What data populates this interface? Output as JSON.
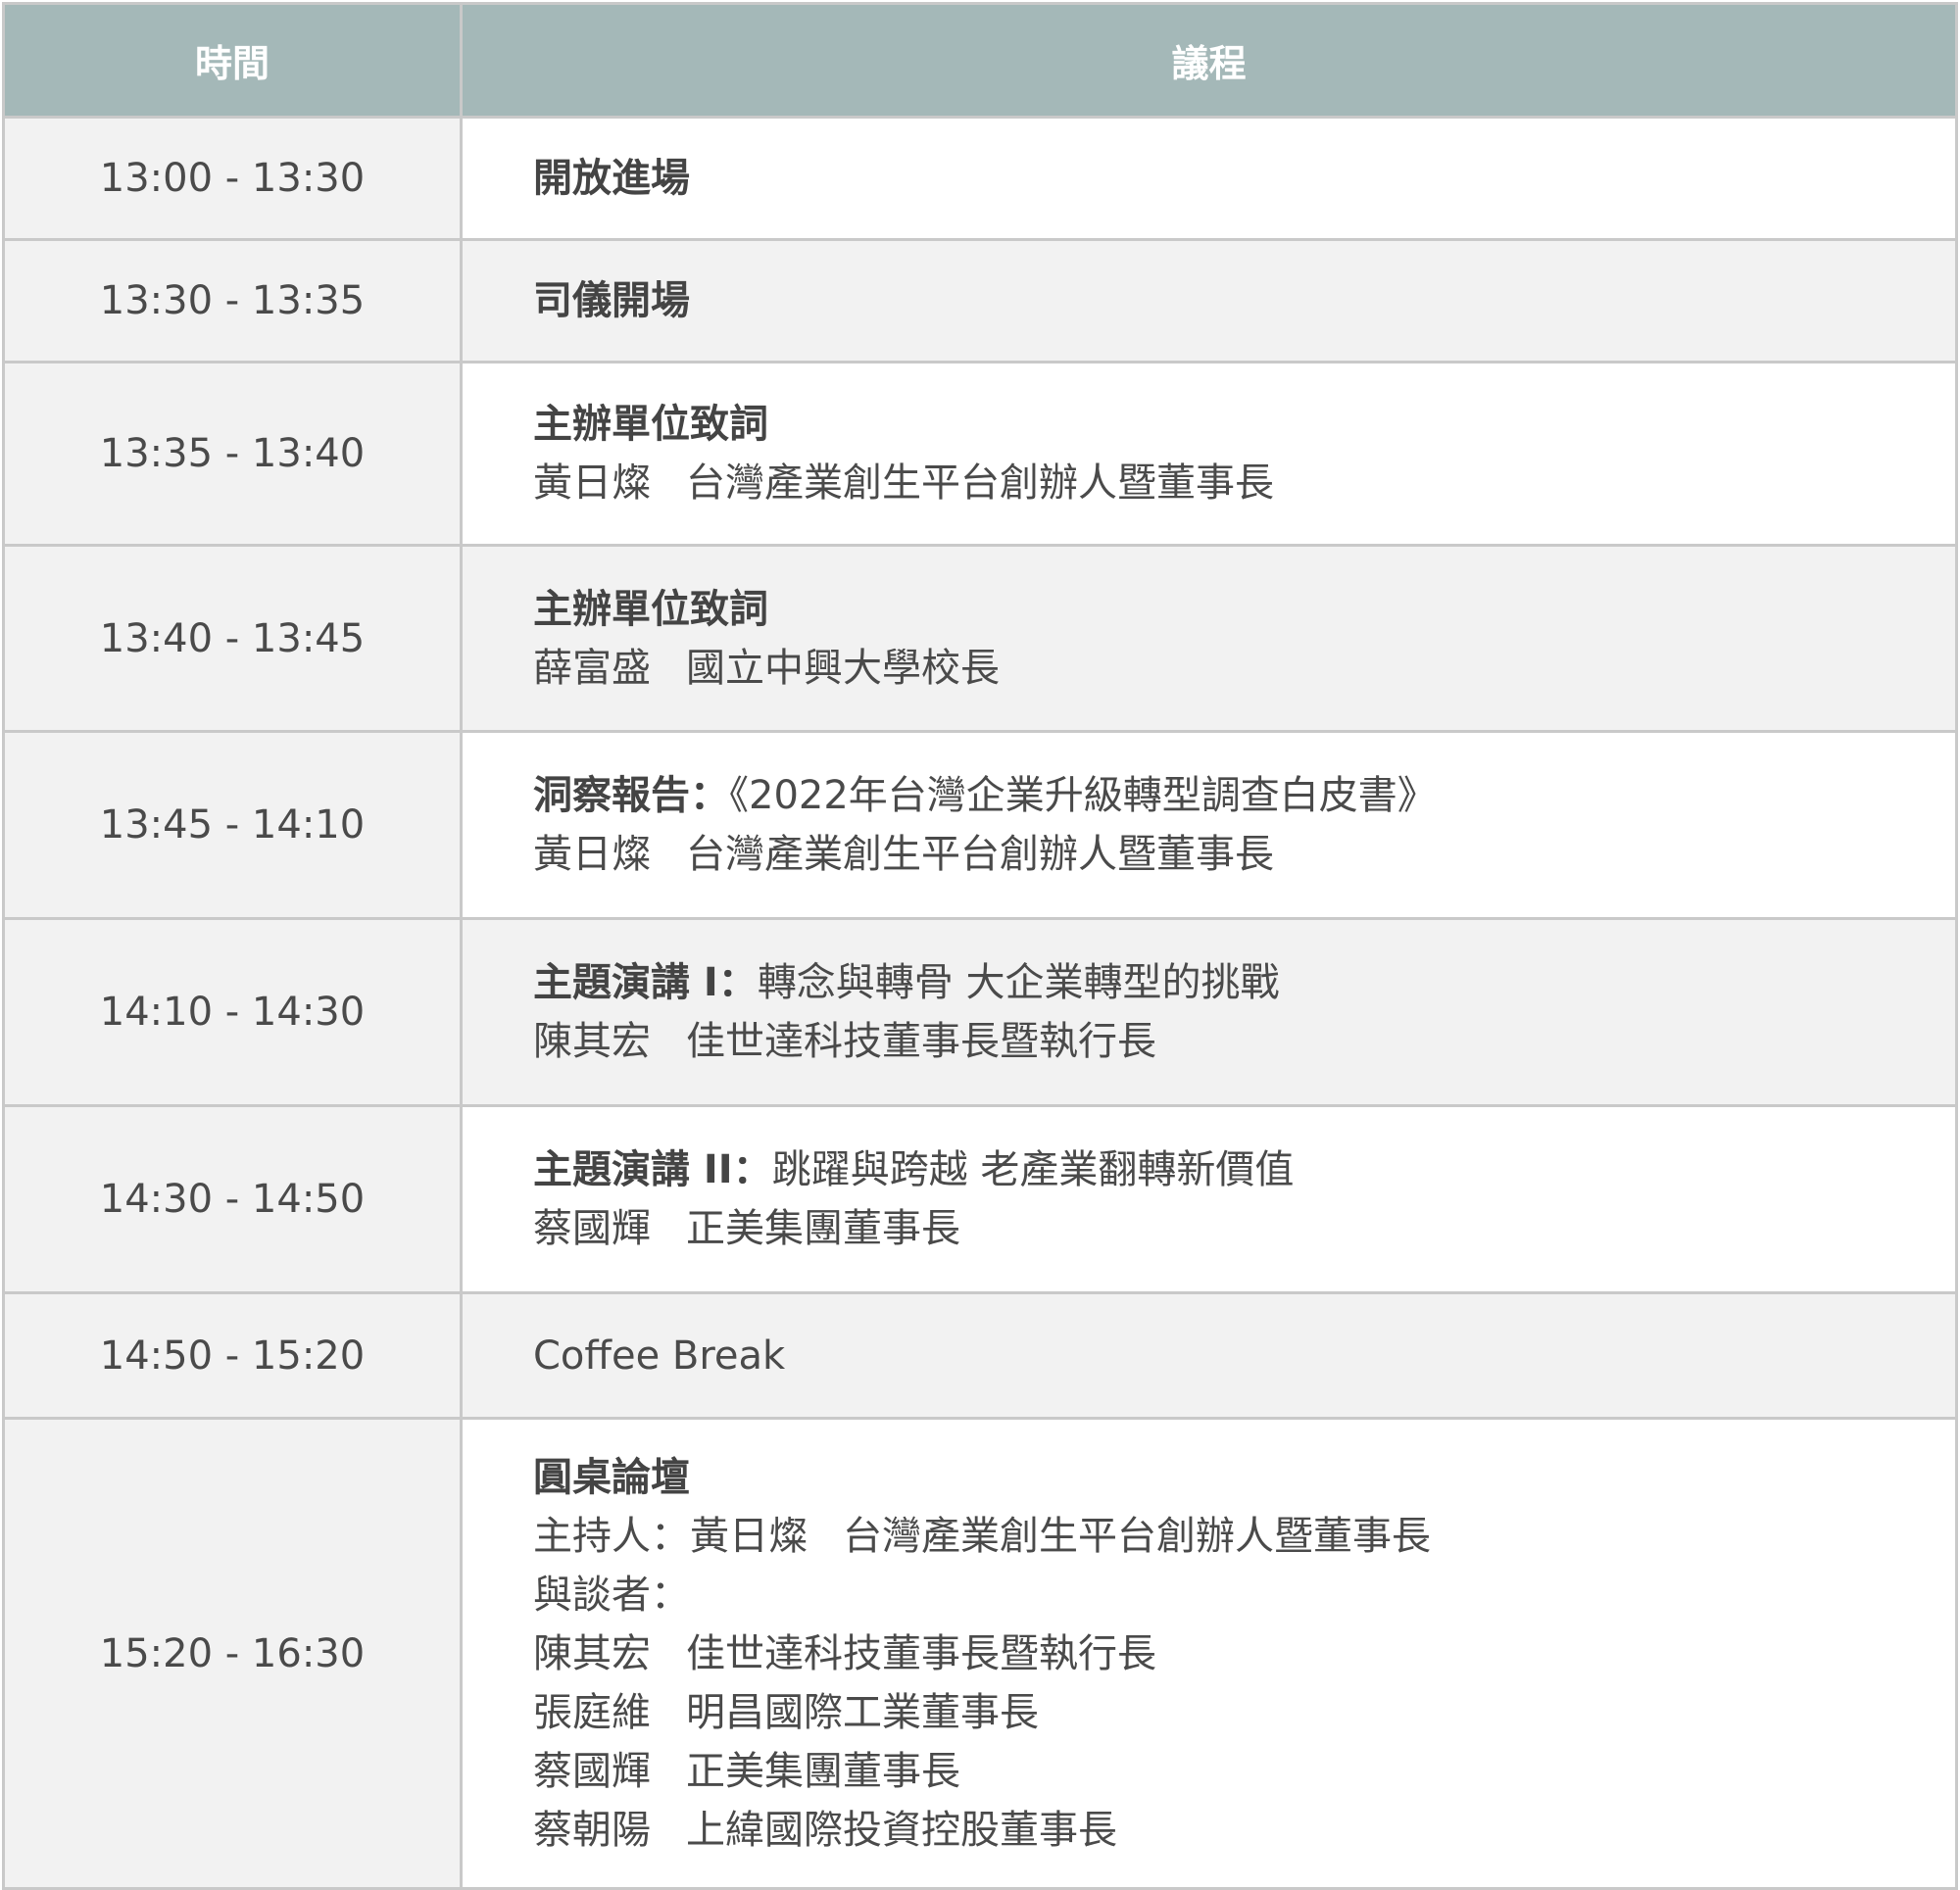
{
  "header": {
    "time": "時間",
    "agenda": "議程"
  },
  "rows": [
    {
      "time": "13:00 - 13:30",
      "title_bold": "開放進場"
    },
    {
      "time": "13:30 - 13:35",
      "title_bold": "司儀開場"
    },
    {
      "time": "13:35 - 13:40",
      "title_bold": "主辦單位致詞",
      "speaker_name": "黃日燦",
      "speaker_title": "台灣產業創生平台創辦人暨董事長"
    },
    {
      "time": "13:40 - 13:45",
      "title_bold": "主辦單位致詞",
      "speaker_name": "薛富盛",
      "speaker_title": "國立中興大學校長"
    },
    {
      "time": "13:45 - 14:10",
      "title_bold": "洞察報告：",
      "title_rest": "《2022年台灣企業升級轉型調查白皮書》",
      "speaker_name": "黃日燦",
      "speaker_title": "台灣產業創生平台創辦人暨董事長"
    },
    {
      "time": "14:10 - 14:30",
      "title_bold": "主題演講 I：",
      "title_rest": "轉念與轉骨 大企業轉型的挑戰",
      "speaker_name": "陳其宏",
      "speaker_title": "佳世達科技董事長暨執行長"
    },
    {
      "time": "14:30 - 14:50",
      "title_bold": "主題演講 II：",
      "title_rest": "跳躍與跨越 老產業翻轉新價值",
      "speaker_name": "蔡國輝",
      "speaker_title": "正美集團董事長"
    },
    {
      "time": "14:50 - 15:20",
      "title_plain": "Coffee Break"
    },
    {
      "time": "15:20 - 16:30",
      "title_bold": "圓桌論壇",
      "moderator_label": "主持人：",
      "moderator_name": "黃日燦",
      "moderator_title": "台灣產業創生平台創辦人暨董事長",
      "panel_label": "與談者：",
      "panelists": [
        {
          "name": "陳其宏",
          "title": "佳世達科技董事長暨執行長"
        },
        {
          "name": "張庭維",
          "title": "明昌國際工業董事長"
        },
        {
          "name": "蔡國輝",
          "title": "正美集團董事長"
        },
        {
          "name": "蔡朝陽",
          "title": "上緯國際投資控股董事長"
        }
      ]
    }
  ]
}
